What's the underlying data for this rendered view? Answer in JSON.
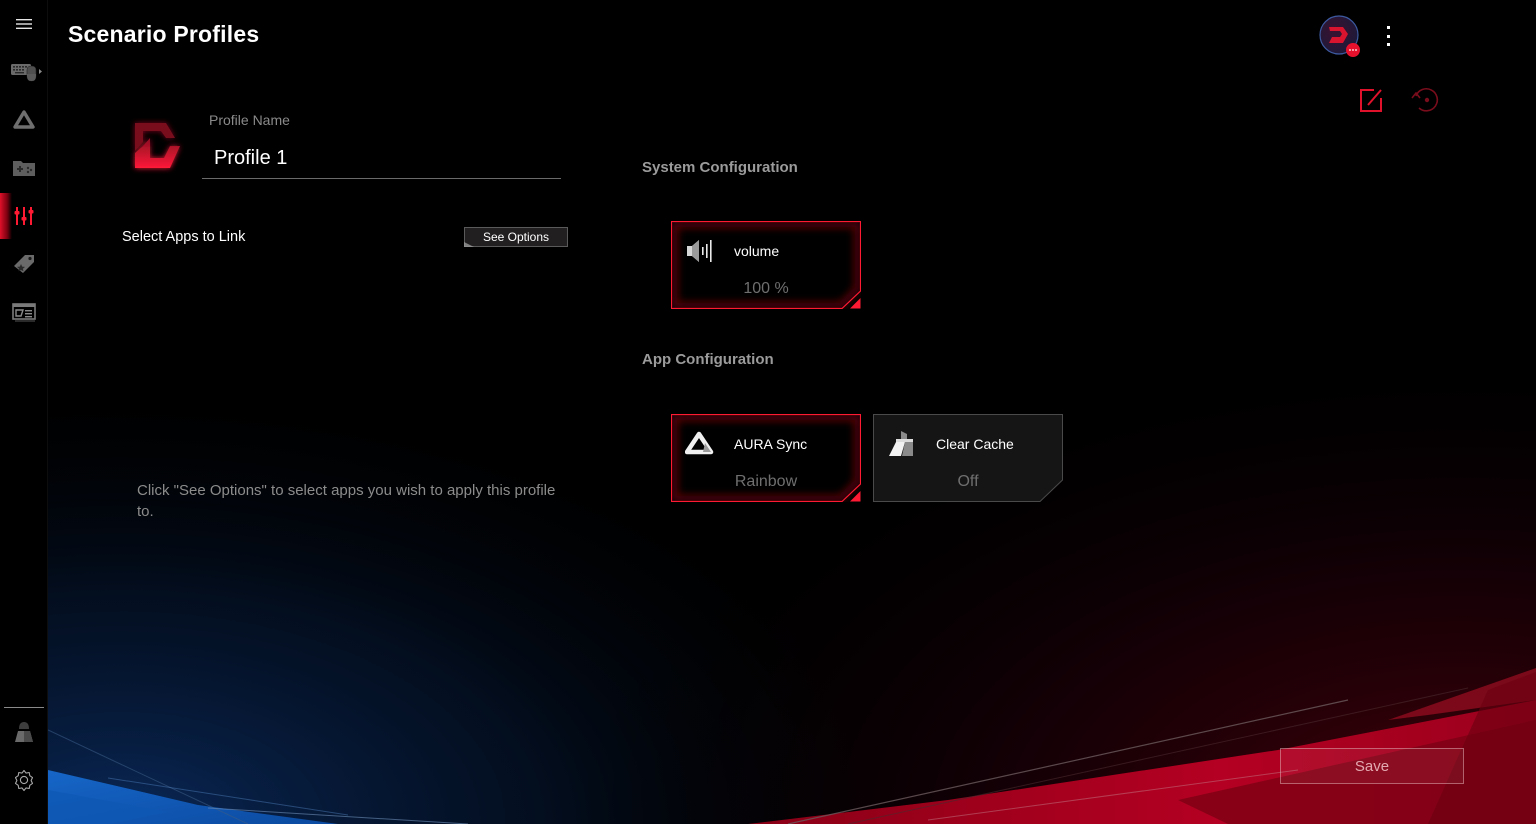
{
  "header": {
    "title": "Scenario Profiles",
    "avatar_badge": "..."
  },
  "sidebar": {
    "items": [
      {
        "id": "menu",
        "icon": "hamburger-menu-icon",
        "active": false
      },
      {
        "id": "devices",
        "icon": "keyboard-mouse-icon",
        "active": false
      },
      {
        "id": "aura",
        "icon": "aura-sync-icon",
        "active": false
      },
      {
        "id": "game-library",
        "icon": "game-folder-icon",
        "active": false
      },
      {
        "id": "scenario-profiles",
        "icon": "equalizer-sliders-icon",
        "active": true
      },
      {
        "id": "deals",
        "icon": "price-tag-star-icon",
        "active": false
      },
      {
        "id": "news",
        "icon": "news-window-icon",
        "active": false
      }
    ],
    "bottom_items": [
      {
        "id": "user",
        "icon": "user-icon"
      },
      {
        "id": "settings",
        "icon": "gear-icon"
      }
    ]
  },
  "profile": {
    "name_label": "Profile Name",
    "name_value": "Profile 1",
    "select_apps_label": "Select Apps to Link",
    "see_options_label": "See Options",
    "hint": "Click \"See Options\" to select apps you wish to apply this profile to."
  },
  "system_configuration": {
    "title": "System Configuration",
    "tiles": [
      {
        "label": "volume",
        "value": "100 %",
        "icon": "speaker-icon",
        "active": true
      }
    ]
  },
  "app_configuration": {
    "title": "App Configuration",
    "tiles": [
      {
        "label": "AURA Sync",
        "value": "Rainbow",
        "icon": "aura-sync-icon",
        "active": true
      },
      {
        "label": "Clear Cache",
        "value": "Off",
        "icon": "broom-icon",
        "active": false
      }
    ]
  },
  "actions": {
    "save_label": "Save",
    "edit_icon": "edit-icon",
    "reset_icon": "reset-icon"
  },
  "colors": {
    "accent": "#e8112d",
    "background": "#000000",
    "muted_text": "#8c8c8c",
    "section_title": "#9b9b9b"
  }
}
